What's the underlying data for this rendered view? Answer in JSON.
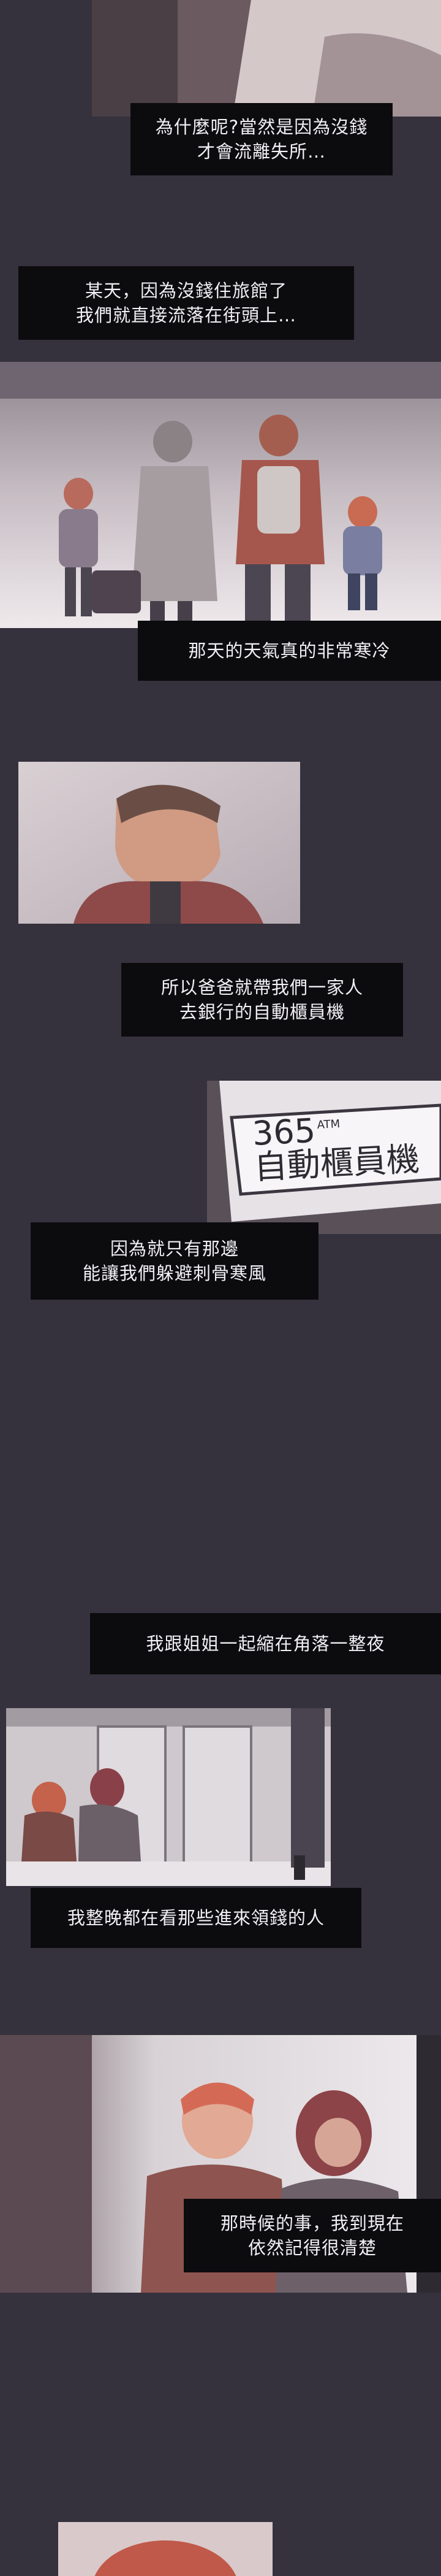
{
  "captions": {
    "c1": [
      "為什麼呢?當然是因為沒錢",
      "才會流離失所…"
    ],
    "c2": [
      "某天，因為沒錢住旅館了",
      "我們就直接流落在街頭上…"
    ],
    "c3": [
      "那天的天氣真的非常寒冷"
    ],
    "c4": [
      "所以爸爸就帶我們一家人",
      "去銀行的自動櫃員機"
    ],
    "c5": [
      "因為就只有那邊",
      "能讓我們躲避刺骨寒風"
    ],
    "c6": [
      "我跟姐姐一起縮在角落一整夜"
    ],
    "c7": [
      "我整晚都在看那些進來領錢的人"
    ],
    "c8": [
      "那時候的事，我到現在",
      "依然記得很清楚"
    ]
  },
  "signs": {
    "atm_number": "365",
    "atm_small": "ATM",
    "atm_label": "自動櫃員機"
  }
}
